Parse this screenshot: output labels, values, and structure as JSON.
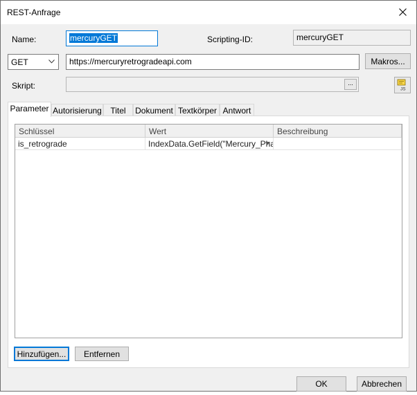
{
  "window": {
    "title": "REST-Anfrage"
  },
  "fields": {
    "name_label": "Name:",
    "name_value": "mercuryGET",
    "scripting_id_label": "Scripting-ID:",
    "scripting_id_value": "mercuryGET",
    "method": "GET",
    "url": "https://mercuryretrogradeapi.com",
    "makros_label": "Makros...",
    "skript_label": "Skript:",
    "skript_browse": "...",
    "js_icon_text": "JS"
  },
  "tabs": [
    {
      "label": "Parameter",
      "active": true
    },
    {
      "label": "Autorisierung"
    },
    {
      "label": "Titel"
    },
    {
      "label": "Dokument"
    },
    {
      "label": "Textkörper"
    },
    {
      "label": "Antwort"
    }
  ],
  "table": {
    "headers": [
      "Schlüssel",
      "Wert",
      "Beschreibung"
    ],
    "rows": [
      [
        "is_retrograde",
        "IndexData.GetField(\"Mercury_Phas",
        ""
      ]
    ]
  },
  "buttons": {
    "add": "Hinzufügen...",
    "remove": "Entfernen",
    "ok": "OK",
    "cancel": "Abbrechen"
  }
}
